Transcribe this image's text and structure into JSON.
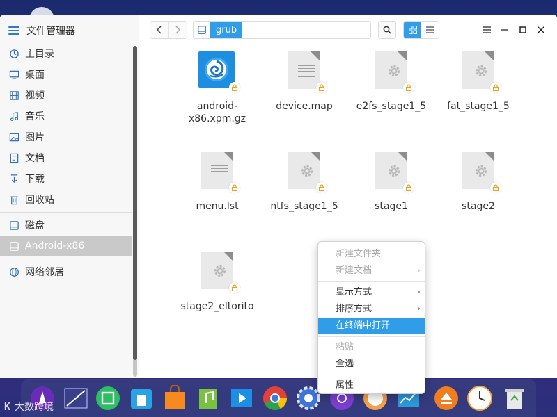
{
  "window": {
    "app_title": "文件管理器"
  },
  "sidebar": {
    "items": [
      {
        "label": "主目录",
        "icon": "home-icon"
      },
      {
        "label": "桌面",
        "icon": "desktop-icon"
      },
      {
        "label": "视频",
        "icon": "video-icon"
      },
      {
        "label": "音乐",
        "icon": "music-icon"
      },
      {
        "label": "图片",
        "icon": "picture-icon"
      },
      {
        "label": "文档",
        "icon": "document-icon"
      },
      {
        "label": "下载",
        "icon": "download-icon"
      },
      {
        "label": "回收站",
        "icon": "trash-icon"
      }
    ],
    "devices": [
      {
        "label": "磁盘",
        "icon": "disk-icon"
      },
      {
        "label": "Android-x86",
        "icon": "drive-icon",
        "active": true
      }
    ],
    "network": [
      {
        "label": "网络邻居",
        "icon": "network-icon"
      }
    ]
  },
  "toolbar": {
    "path_segment": "grub",
    "view_mode": "icon"
  },
  "files": [
    {
      "name": "android-x86.xpm.gz",
      "type": "app-image"
    },
    {
      "name": "device.map",
      "type": "text"
    },
    {
      "name": "e2fs_stage1_5",
      "type": "binary"
    },
    {
      "name": "fat_stage1_5",
      "type": "binary"
    },
    {
      "name": "menu.lst",
      "type": "text"
    },
    {
      "name": "ntfs_stage1_5",
      "type": "binary"
    },
    {
      "name": "stage1",
      "type": "binary"
    },
    {
      "name": "stage2",
      "type": "binary"
    },
    {
      "name": "stage2_eltorito",
      "type": "binary"
    }
  ],
  "context_menu": {
    "groups": [
      [
        {
          "label": "新建文件夹",
          "disabled": true
        },
        {
          "label": "新建文档",
          "disabled": true,
          "submenu": true
        }
      ],
      [
        {
          "label": "显示方式",
          "submenu": true
        },
        {
          "label": "排序方式",
          "submenu": true
        },
        {
          "label": "在终端中打开",
          "highlighted": true
        }
      ],
      [
        {
          "label": "粘贴",
          "disabled": true
        },
        {
          "label": "全选"
        }
      ],
      [
        {
          "label": "属性"
        }
      ]
    ]
  },
  "colors": {
    "accent": "#2f9de8",
    "sidebar_active": "#c9c9c9",
    "icon_blue": "#2a6fb8"
  },
  "dock": {
    "apps": [
      "launcher-icon",
      "screenshot-icon",
      "app-store-icon",
      "file-manager-icon",
      "shopping-icon",
      "music-player-icon",
      "video-player-icon",
      "chrome-icon",
      "settings-icon",
      "music-disc-icon",
      "clock-app-icon",
      "uploader-icon",
      "system-monitor-icon",
      "eject-icon",
      "clock-icon",
      "trash-bin-icon"
    ]
  },
  "watermark": {
    "text": "大数跨境",
    "logo": "K"
  }
}
